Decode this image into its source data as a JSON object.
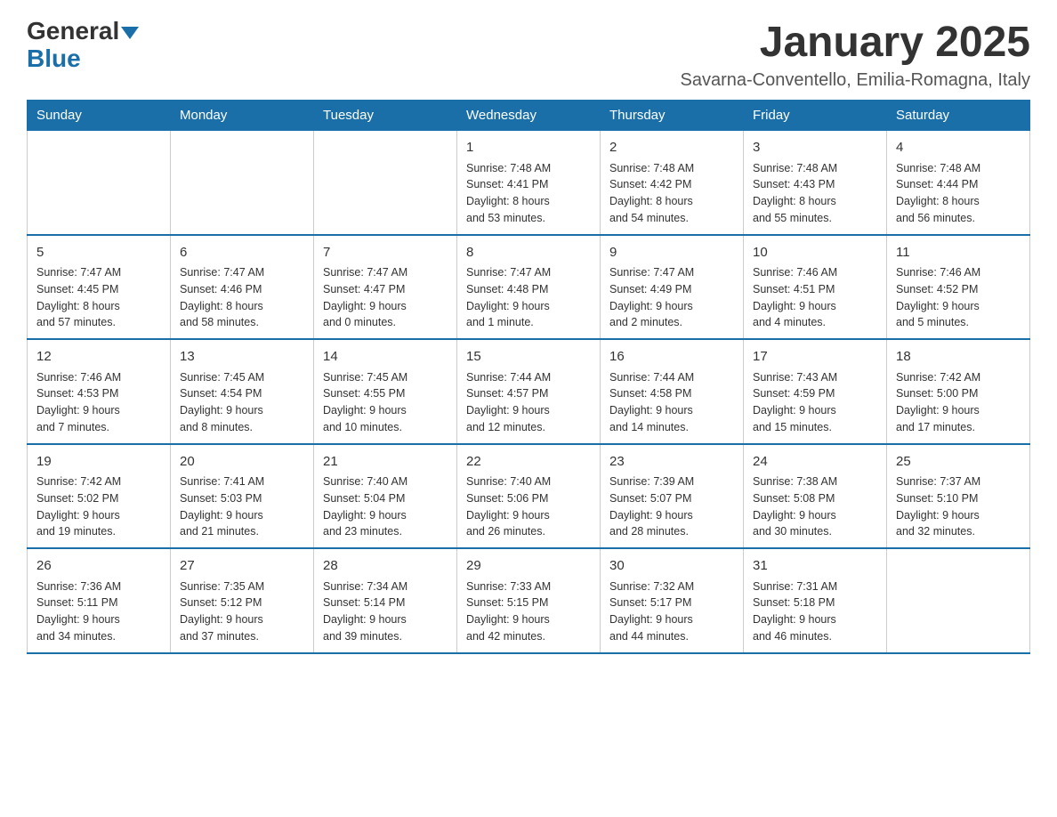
{
  "header": {
    "logo_general": "General",
    "logo_blue": "Blue",
    "month_title": "January 2025",
    "location": "Savarna-Conventello, Emilia-Romagna, Italy"
  },
  "weekdays": [
    "Sunday",
    "Monday",
    "Tuesday",
    "Wednesday",
    "Thursday",
    "Friday",
    "Saturday"
  ],
  "weeks": [
    [
      {
        "day": "",
        "info": ""
      },
      {
        "day": "",
        "info": ""
      },
      {
        "day": "",
        "info": ""
      },
      {
        "day": "1",
        "info": "Sunrise: 7:48 AM\nSunset: 4:41 PM\nDaylight: 8 hours\nand 53 minutes."
      },
      {
        "day": "2",
        "info": "Sunrise: 7:48 AM\nSunset: 4:42 PM\nDaylight: 8 hours\nand 54 minutes."
      },
      {
        "day": "3",
        "info": "Sunrise: 7:48 AM\nSunset: 4:43 PM\nDaylight: 8 hours\nand 55 minutes."
      },
      {
        "day": "4",
        "info": "Sunrise: 7:48 AM\nSunset: 4:44 PM\nDaylight: 8 hours\nand 56 minutes."
      }
    ],
    [
      {
        "day": "5",
        "info": "Sunrise: 7:47 AM\nSunset: 4:45 PM\nDaylight: 8 hours\nand 57 minutes."
      },
      {
        "day": "6",
        "info": "Sunrise: 7:47 AM\nSunset: 4:46 PM\nDaylight: 8 hours\nand 58 minutes."
      },
      {
        "day": "7",
        "info": "Sunrise: 7:47 AM\nSunset: 4:47 PM\nDaylight: 9 hours\nand 0 minutes."
      },
      {
        "day": "8",
        "info": "Sunrise: 7:47 AM\nSunset: 4:48 PM\nDaylight: 9 hours\nand 1 minute."
      },
      {
        "day": "9",
        "info": "Sunrise: 7:47 AM\nSunset: 4:49 PM\nDaylight: 9 hours\nand 2 minutes."
      },
      {
        "day": "10",
        "info": "Sunrise: 7:46 AM\nSunset: 4:51 PM\nDaylight: 9 hours\nand 4 minutes."
      },
      {
        "day": "11",
        "info": "Sunrise: 7:46 AM\nSunset: 4:52 PM\nDaylight: 9 hours\nand 5 minutes."
      }
    ],
    [
      {
        "day": "12",
        "info": "Sunrise: 7:46 AM\nSunset: 4:53 PM\nDaylight: 9 hours\nand 7 minutes."
      },
      {
        "day": "13",
        "info": "Sunrise: 7:45 AM\nSunset: 4:54 PM\nDaylight: 9 hours\nand 8 minutes."
      },
      {
        "day": "14",
        "info": "Sunrise: 7:45 AM\nSunset: 4:55 PM\nDaylight: 9 hours\nand 10 minutes."
      },
      {
        "day": "15",
        "info": "Sunrise: 7:44 AM\nSunset: 4:57 PM\nDaylight: 9 hours\nand 12 minutes."
      },
      {
        "day": "16",
        "info": "Sunrise: 7:44 AM\nSunset: 4:58 PM\nDaylight: 9 hours\nand 14 minutes."
      },
      {
        "day": "17",
        "info": "Sunrise: 7:43 AM\nSunset: 4:59 PM\nDaylight: 9 hours\nand 15 minutes."
      },
      {
        "day": "18",
        "info": "Sunrise: 7:42 AM\nSunset: 5:00 PM\nDaylight: 9 hours\nand 17 minutes."
      }
    ],
    [
      {
        "day": "19",
        "info": "Sunrise: 7:42 AM\nSunset: 5:02 PM\nDaylight: 9 hours\nand 19 minutes."
      },
      {
        "day": "20",
        "info": "Sunrise: 7:41 AM\nSunset: 5:03 PM\nDaylight: 9 hours\nand 21 minutes."
      },
      {
        "day": "21",
        "info": "Sunrise: 7:40 AM\nSunset: 5:04 PM\nDaylight: 9 hours\nand 23 minutes."
      },
      {
        "day": "22",
        "info": "Sunrise: 7:40 AM\nSunset: 5:06 PM\nDaylight: 9 hours\nand 26 minutes."
      },
      {
        "day": "23",
        "info": "Sunrise: 7:39 AM\nSunset: 5:07 PM\nDaylight: 9 hours\nand 28 minutes."
      },
      {
        "day": "24",
        "info": "Sunrise: 7:38 AM\nSunset: 5:08 PM\nDaylight: 9 hours\nand 30 minutes."
      },
      {
        "day": "25",
        "info": "Sunrise: 7:37 AM\nSunset: 5:10 PM\nDaylight: 9 hours\nand 32 minutes."
      }
    ],
    [
      {
        "day": "26",
        "info": "Sunrise: 7:36 AM\nSunset: 5:11 PM\nDaylight: 9 hours\nand 34 minutes."
      },
      {
        "day": "27",
        "info": "Sunrise: 7:35 AM\nSunset: 5:12 PM\nDaylight: 9 hours\nand 37 minutes."
      },
      {
        "day": "28",
        "info": "Sunrise: 7:34 AM\nSunset: 5:14 PM\nDaylight: 9 hours\nand 39 minutes."
      },
      {
        "day": "29",
        "info": "Sunrise: 7:33 AM\nSunset: 5:15 PM\nDaylight: 9 hours\nand 42 minutes."
      },
      {
        "day": "30",
        "info": "Sunrise: 7:32 AM\nSunset: 5:17 PM\nDaylight: 9 hours\nand 44 minutes."
      },
      {
        "day": "31",
        "info": "Sunrise: 7:31 AM\nSunset: 5:18 PM\nDaylight: 9 hours\nand 46 minutes."
      },
      {
        "day": "",
        "info": ""
      }
    ]
  ]
}
